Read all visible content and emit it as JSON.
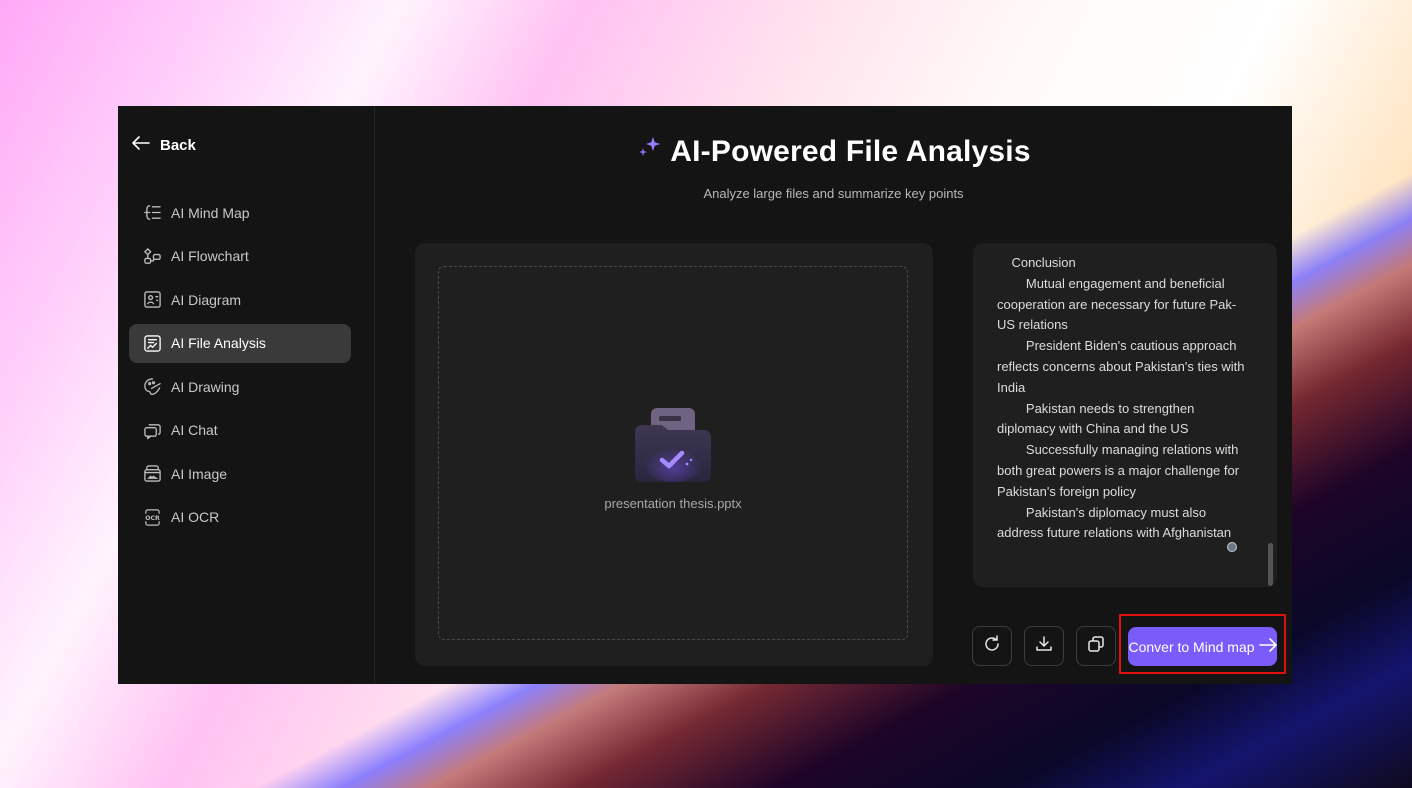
{
  "sidebar": {
    "back_label": "Back",
    "items": [
      {
        "label": "AI Mind Map",
        "icon": "mind-map-icon",
        "active": false
      },
      {
        "label": "AI Flowchart",
        "icon": "flowchart-icon",
        "active": false
      },
      {
        "label": "AI Diagram",
        "icon": "diagram-icon",
        "active": false
      },
      {
        "label": "AI File Analysis",
        "icon": "file-analysis-icon",
        "active": true
      },
      {
        "label": "AI Drawing",
        "icon": "palette-icon",
        "active": false
      },
      {
        "label": "AI Chat",
        "icon": "chat-icon",
        "active": false
      },
      {
        "label": "AI Image",
        "icon": "image-icon",
        "active": false
      },
      {
        "label": "AI OCR",
        "icon": "ocr-icon",
        "active": false
      }
    ]
  },
  "header": {
    "title": "AI-Powered File Analysis",
    "subtitle": "Analyze large files and summarize key points"
  },
  "upload": {
    "file_name": "presentation thesis.pptx"
  },
  "result": {
    "text": "    Conclusion\n        Mutual engagement and beneficial cooperation are necessary for future Pak-US relations\n        President Biden's cautious approach reflects concerns about Pakistan's ties with India\n        Pakistan needs to strengthen diplomacy with China and the US\n        Successfully managing relations with both great powers is a major challenge for Pakistan's foreign policy\n        Pakistan's diplomacy must also address future relations with Afghanistan"
  },
  "actions": {
    "regenerate": "regenerate",
    "download": "download",
    "copy": "copy",
    "convert_label": "Conver to Mind map"
  },
  "colors": {
    "accent": "#7b5cfa",
    "highlight_box": "#e01010",
    "app_bg": "#141414",
    "panel_bg": "#1f1f1f"
  }
}
